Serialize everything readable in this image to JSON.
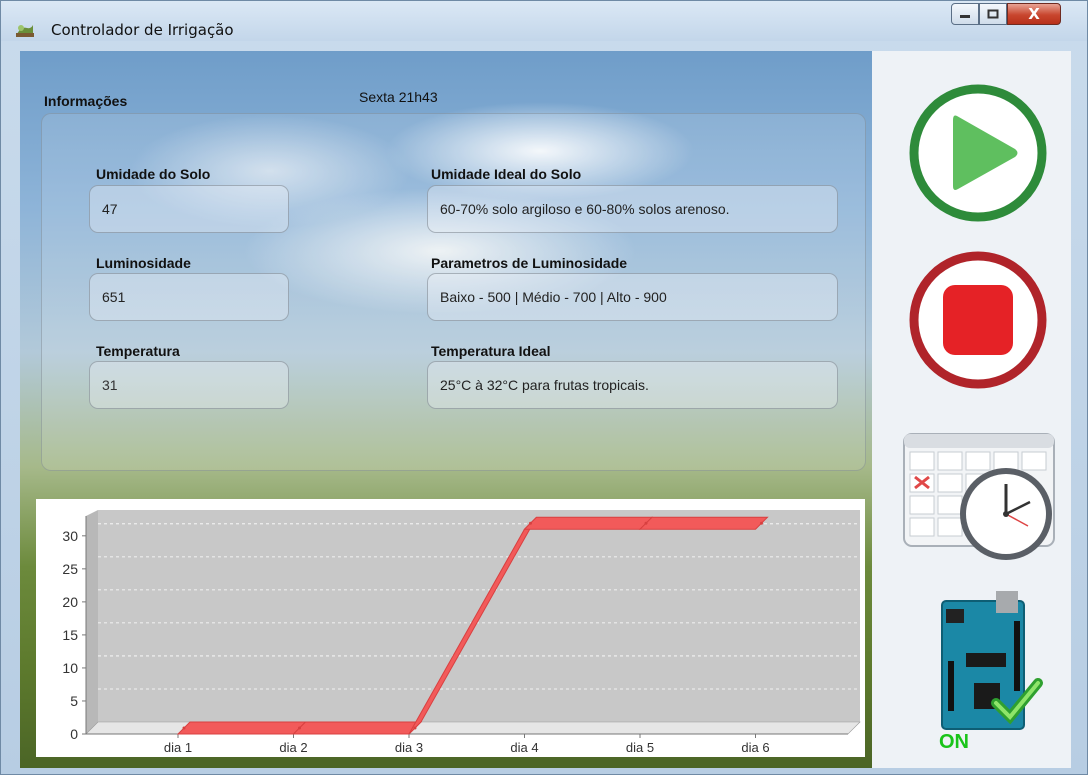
{
  "window": {
    "title": "Controlador de Irrigação",
    "close_glyph": "X"
  },
  "info": {
    "section_label": "Informações",
    "datetime": "Sexta 21h43"
  },
  "fields": {
    "soil_moisture": {
      "label": "Umidade do Solo",
      "value": "47"
    },
    "ideal_soil_moisture": {
      "label": "Umidade Ideal do Solo",
      "value": "60-70% solo argiloso e 60-80% solos arenoso."
    },
    "luminosity": {
      "label": "Luminosidade",
      "value": "651"
    },
    "luminosity_params": {
      "label": "Parametros de Luminosidade",
      "value": "Baixo - 500 | Médio - 700 | Alto - 900"
    },
    "temperature": {
      "label": "Temperatura",
      "value": "31"
    },
    "ideal_temperature": {
      "label": "Temperatura Ideal",
      "value": "25°C à 32°C para frutas tropicais."
    }
  },
  "controls": {
    "play_icon": "play-icon",
    "stop_icon": "stop-icon",
    "schedule_icon": "calendar-clock-icon",
    "board_icon": "arduino-board-icon",
    "board_status": "ON"
  },
  "colors": {
    "play": "#2e8b3a",
    "play_fill": "#5fbf5f",
    "stop": "#b0242a",
    "stop_fill": "#e52226",
    "series": "#f25a5a",
    "status_on": "#19c419"
  },
  "chart_data": {
    "type": "line",
    "style": "3d",
    "categories": [
      "dia 1",
      "dia 2",
      "dia 3",
      "dia 4",
      "dia 5",
      "dia 6"
    ],
    "series": [
      {
        "values": [
          0,
          0,
          0,
          31,
          31,
          31
        ]
      }
    ],
    "yticks": [
      0,
      5,
      10,
      15,
      20,
      25,
      30
    ],
    "ylim": [
      0,
      33
    ],
    "grid": true,
    "title": "",
    "xlabel": "",
    "ylabel": ""
  }
}
